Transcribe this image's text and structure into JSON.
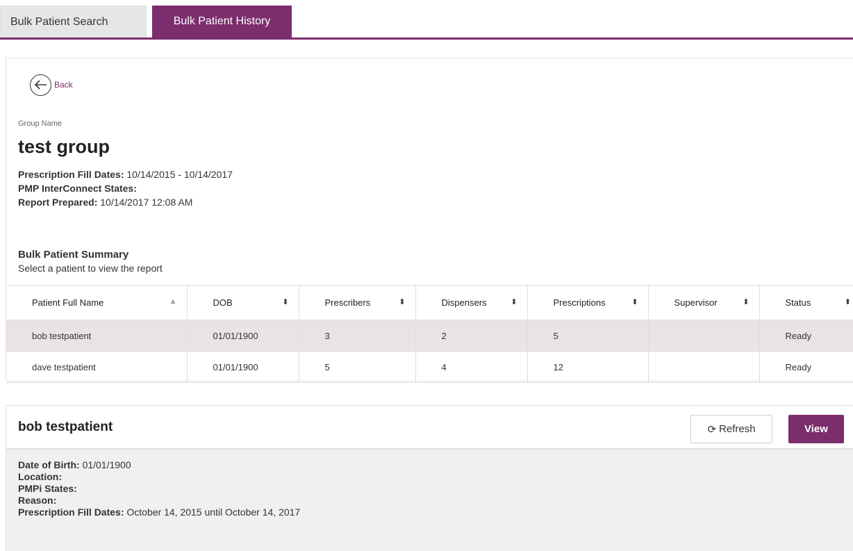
{
  "tabs": [
    {
      "label": "Bulk Patient Search",
      "active": false
    },
    {
      "label": "Bulk Patient History",
      "active": true
    }
  ],
  "report": {
    "back_label": "Back",
    "group_label": "Group Name",
    "group_name": "test group",
    "fill_dates_label": "Prescription Fill Dates:",
    "fill_dates_value": "10/14/2015 - 10/14/2017",
    "interconnect_label": "PMP InterConnect States:",
    "interconnect_value": "",
    "prepared_label": "Report Prepared:",
    "prepared_value": "10/14/2017 12:08 AM",
    "summary_title": "Bulk Patient Summary",
    "summary_subtitle": "Select a patient to view the report"
  },
  "table": {
    "columns": [
      "Patient Full Name",
      "DOB",
      "Prescribers",
      "Dispensers",
      "Prescriptions",
      "Supervisor",
      "Status"
    ],
    "rows": [
      {
        "name": "bob testpatient",
        "dob": "01/01/1900",
        "prescribers": "3",
        "dispensers": "2",
        "prescriptions": "5",
        "supervisor": "",
        "status": "Ready",
        "selected": true
      },
      {
        "name": "dave testpatient",
        "dob": "01/01/1900",
        "prescribers": "5",
        "dispensers": "4",
        "prescriptions": "12",
        "supervisor": "",
        "status": "Ready",
        "selected": false
      }
    ]
  },
  "patient": {
    "name": "bob testpatient",
    "refresh_label": "Refresh",
    "view_label": "View",
    "dob_label": "Date of Birth:",
    "dob_value": "01/01/1900",
    "location_label": "Location:",
    "location_value": "",
    "pmpi_label": "PMPi States:",
    "pmpi_value": "",
    "reason_label": "Reason:",
    "reason_value": "",
    "fill_dates_label": "Prescription Fill Dates:",
    "fill_dates_value": "October 14, 2015 until October 14, 2017"
  },
  "colors": {
    "accent": "#7b2d6e",
    "status_ready": "#2e8b3a",
    "selected_row": "#e9e3e8"
  }
}
